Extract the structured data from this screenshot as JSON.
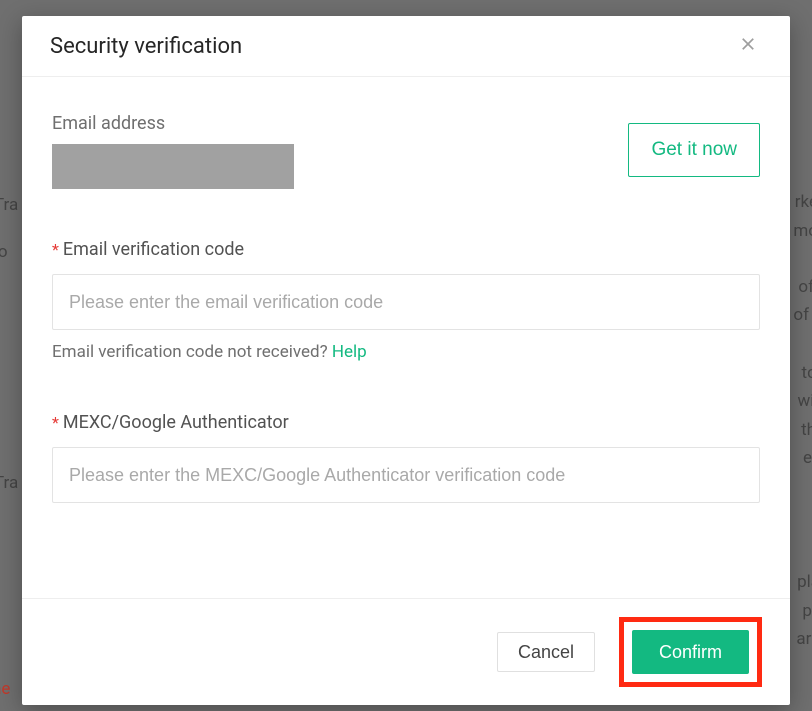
{
  "modal": {
    "title": "Security verification",
    "email_label": "Email address",
    "get_it_now": "Get it now",
    "email_code": {
      "label": "Email verification code",
      "placeholder": "Please enter the email verification code",
      "helper_text": "Email verification code not received? ",
      "help_link": "Help"
    },
    "authenticator": {
      "label": "MEXC/Google Authenticator",
      "placeholder": "Please enter the MEXC/Google Authenticator verification code"
    },
    "footer": {
      "cancel": "Cancel",
      "confirm": "Confirm"
    }
  },
  "colors": {
    "accent": "#13b981",
    "highlight_ring": "#ff2a12"
  }
}
